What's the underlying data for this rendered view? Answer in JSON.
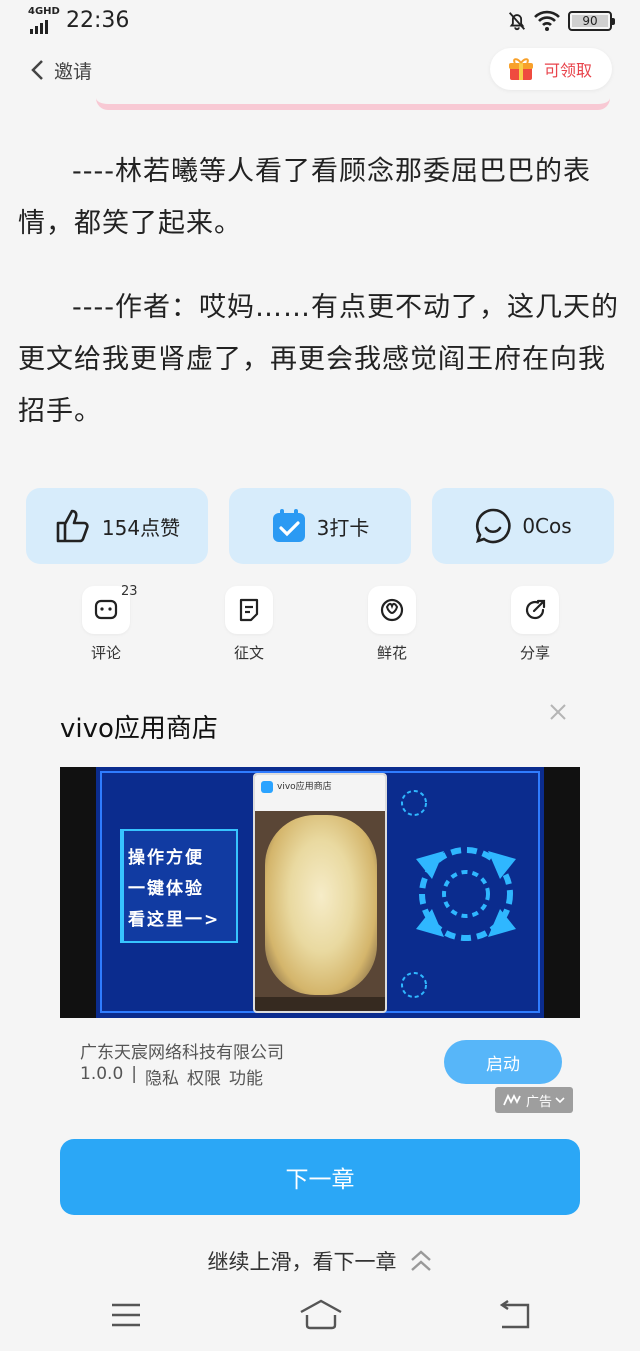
{
  "status_bar": {
    "network": "4GHD",
    "time": "22:36",
    "battery": "90"
  },
  "header": {
    "back_label": "邀请",
    "reward_label": "可领取"
  },
  "article": {
    "paragraphs": [
      "----林若曦等人看了看顾念那委屈巴巴的表情，都笑了起来。",
      "----作者：哎妈……有点更不动了，这几天的更文给我更肾虚了，再更会我感觉阎王府在向我招手。"
    ]
  },
  "actions": {
    "like": "154点赞",
    "checkin": "3打卡",
    "cos": "0Cos"
  },
  "icon_row": {
    "comment": "评论",
    "comment_count": "23",
    "essay": "征文",
    "flower": "鲜花",
    "share": "分享"
  },
  "ad": {
    "title": "vivo应用商店",
    "image_lines": [
      "操作方便",
      "一键体验",
      "看这里一>"
    ],
    "image_app_name": "vivo应用商店",
    "company": "广东天宸网络科技有限公司",
    "version": "1.0.0",
    "separator": "|",
    "links": [
      "隐私",
      "权限",
      "功能"
    ],
    "start_label": "启动",
    "tag": "广告"
  },
  "next_chapter": "下一章",
  "swipe_hint": "继续上滑，看下一章"
}
